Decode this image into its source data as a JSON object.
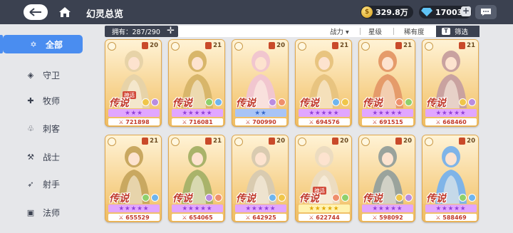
{
  "header": {
    "title": "幻灵总览",
    "gold": "329.8万",
    "gems": "17003",
    "plus": "+"
  },
  "sidebar": {
    "items": [
      {
        "label": "全部",
        "icon": "star-icon",
        "glyph": "✡"
      },
      {
        "label": "守卫",
        "icon": "shield-icon",
        "glyph": "◈"
      },
      {
        "label": "牧师",
        "icon": "cross-icon",
        "glyph": "✚"
      },
      {
        "label": "刺客",
        "icon": "dagger-icon",
        "glyph": "♧"
      },
      {
        "label": "战士",
        "icon": "axe-icon",
        "glyph": "⚒"
      },
      {
        "label": "射手",
        "icon": "bow-icon",
        "glyph": "➶"
      },
      {
        "label": "法师",
        "icon": "book-icon",
        "glyph": "▣"
      }
    ]
  },
  "filterbar": {
    "owned": "拥有：287/290",
    "sort_power": "战力 ▾",
    "sort_star": "星级",
    "sort_rarity": "稀有度",
    "filter": "筛选",
    "filter_icon": "T"
  },
  "colors": {
    "topbar": "#3b4150",
    "accent": "#4a8df0",
    "card_gold": "#f4c877",
    "rarity_red": "#c0392b"
  },
  "cards": [
    {
      "level": "20",
      "rarity": "传说",
      "tag": "神话",
      "stars": "★★★",
      "star_style": "purple",
      "power": "⚔ 721898",
      "art": "#e7d3a8"
    },
    {
      "level": "21",
      "rarity": "传说",
      "tag": "",
      "stars": "★★★★★",
      "star_style": "purple",
      "power": "⚔ 716081",
      "art": "#d8b66a"
    },
    {
      "level": "20",
      "rarity": "传说",
      "tag": "",
      "stars": "★★",
      "star_style": "blue",
      "power": "⚔ 700990",
      "art": "#f1c6cf"
    },
    {
      "level": "21",
      "rarity": "传说",
      "tag": "",
      "stars": "★★★★★",
      "star_style": "purple",
      "power": "⚔ 694576",
      "art": "#e8c480"
    },
    {
      "level": "21",
      "rarity": "传说",
      "tag": "",
      "stars": "★★★★★",
      "star_style": "purple",
      "power": "⚔ 691515",
      "art": "#e59b6a"
    },
    {
      "level": "21",
      "rarity": "传说",
      "tag": "",
      "stars": "★★★★★",
      "star_style": "purple",
      "power": "⚔ 668460",
      "art": "#c9a2a0"
    },
    {
      "level": "21",
      "rarity": "传说",
      "tag": "",
      "stars": "★★★★★",
      "star_style": "purple",
      "power": "⚔ 655529",
      "art": "#c9a860"
    },
    {
      "level": "21",
      "rarity": "传说",
      "tag": "",
      "stars": "★★★★★",
      "star_style": "purple",
      "power": "⚔ 654065",
      "art": "#a9b36a"
    },
    {
      "level": "20",
      "rarity": "传说",
      "tag": "",
      "stars": "★★★★★",
      "star_style": "purple",
      "power": "⚔ 642925",
      "art": "#d9cbb0"
    },
    {
      "level": "20",
      "rarity": "传说",
      "tag": "神话",
      "stars": "★★★★★",
      "star_style": "gold",
      "power": "⚔ 622744",
      "art": "#ecdcc0"
    },
    {
      "level": "20",
      "rarity": "传说",
      "tag": "",
      "stars": "★★★★★",
      "star_style": "purple",
      "power": "⚔ 598092",
      "art": "#9aa39c"
    },
    {
      "level": "20",
      "rarity": "传说",
      "tag": "",
      "stars": "★★★★★",
      "star_style": "purple",
      "power": "⚔ 588469",
      "art": "#7fb4e8"
    }
  ]
}
